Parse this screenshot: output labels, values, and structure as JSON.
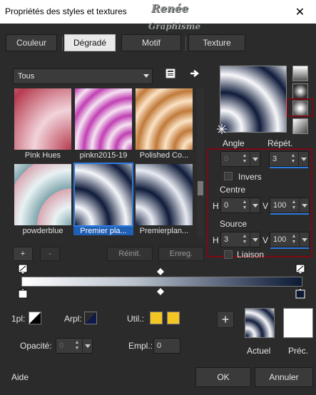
{
  "window": {
    "title": "Propriétés des styles et textures",
    "close_glyph": "✕"
  },
  "watermark": {
    "line1": "Renée",
    "line2": "Graphisme"
  },
  "tabs": [
    {
      "label": "Couleur",
      "active": false
    },
    {
      "label": "Dégradé",
      "active": true
    },
    {
      "label": "Motif",
      "active": false
    },
    {
      "label": "Texture",
      "active": false
    }
  ],
  "category": {
    "value": "Tous"
  },
  "thumbnails": [
    {
      "label": "Pink Hues"
    },
    {
      "label": "pinkn2015-19"
    },
    {
      "label": "Polished Co..."
    },
    {
      "label": "powderblue"
    },
    {
      "label": "Premier pla...",
      "selected": true
    },
    {
      "label": "Premierplan..."
    }
  ],
  "list_buttons": {
    "add": "+",
    "remove": "-",
    "reset": "Réinit.",
    "save": "Enreg."
  },
  "gradient": {
    "angle_label": "Angle",
    "angle_value": "0",
    "repeat_label": "Répét.",
    "repeat_value": "3",
    "invert_label": "Invers",
    "center_label": "Centre",
    "center_h_label": "H",
    "center_h": "0",
    "center_v_label": "V",
    "center_v": "100",
    "source_label": "Source",
    "source_h_label": "H",
    "source_h": "3",
    "source_v_label": "V",
    "source_v": "100",
    "link_label": "Liaison"
  },
  "stops": {
    "first_label": "1pl:",
    "back_label": "Arpl:",
    "used_label": "Util.:",
    "opacity_label": "Opacité:",
    "opacity_value": "0",
    "location_label": "Empl.:",
    "location_value": "0",
    "used_color": "#f3c623"
  },
  "result": {
    "current_label": "Actuel",
    "previous_label": "Préc.",
    "add_glyph": "+"
  },
  "footer": {
    "help": "Aide",
    "ok": "OK",
    "cancel": "Annuler"
  }
}
